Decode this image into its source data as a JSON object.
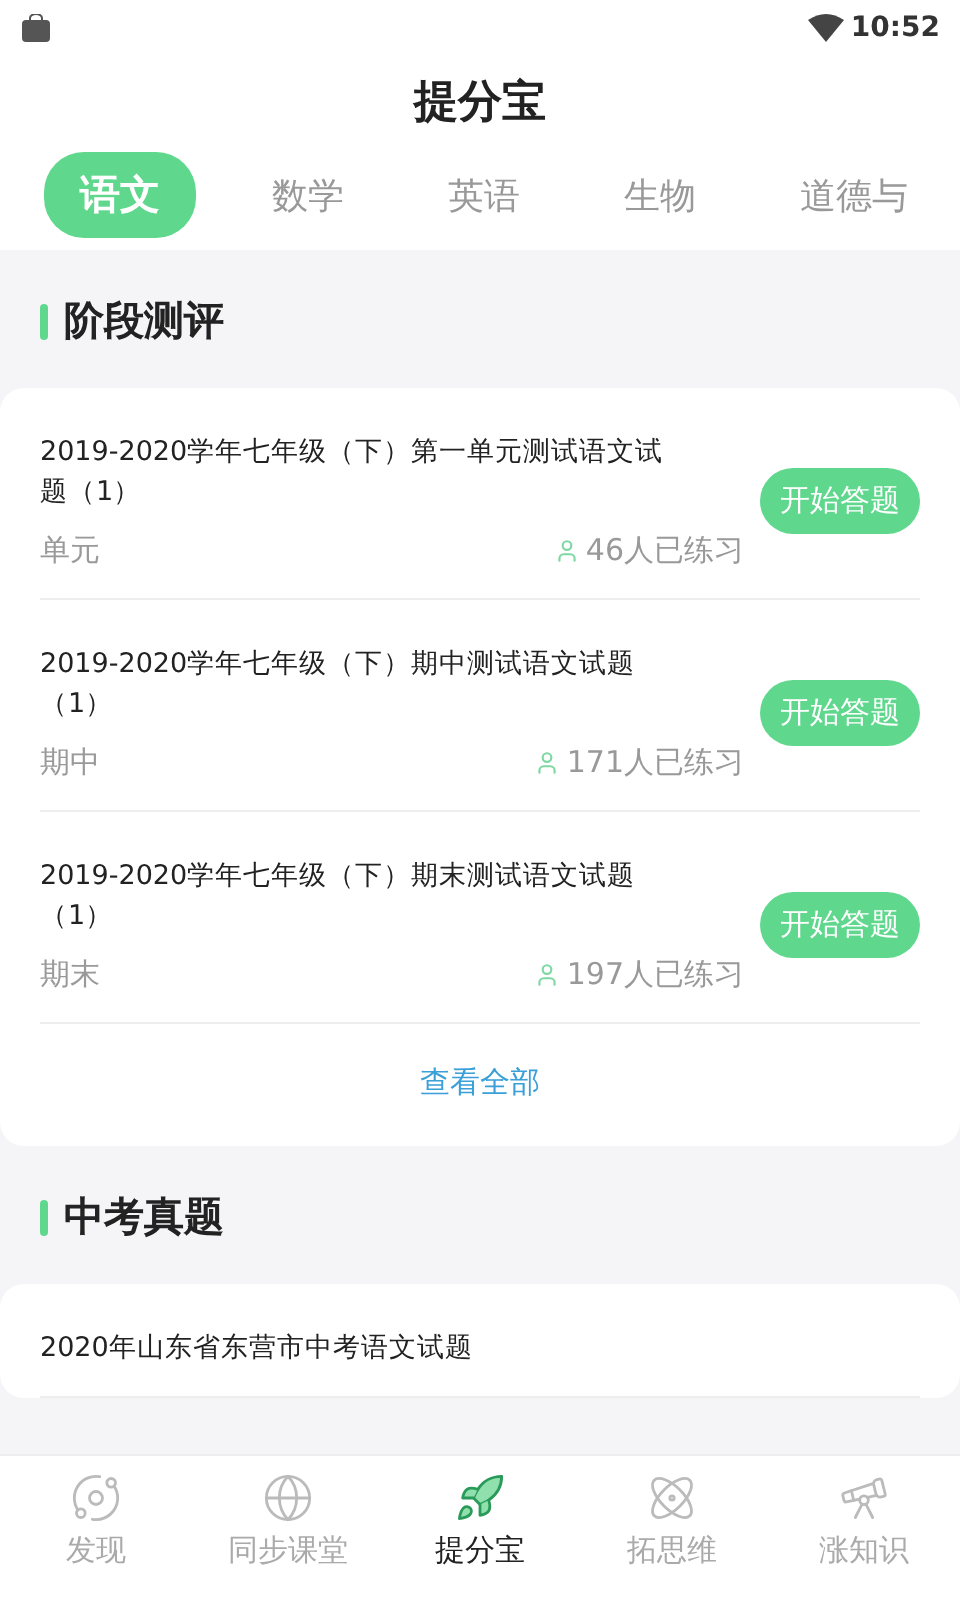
{
  "status_bar": {
    "time": "10:52"
  },
  "title": "提分宝",
  "tabs": [
    {
      "label": "语文",
      "selected": true
    },
    {
      "label": "数学",
      "selected": false
    },
    {
      "label": "英语",
      "selected": false
    },
    {
      "label": "生物",
      "selected": false
    },
    {
      "label": "道德与",
      "selected": false
    }
  ],
  "sections": [
    {
      "heading": "阶段测评",
      "items": [
        {
          "title": "2019-2020学年七年级（下）第一单元测试语文试题（1）",
          "tag": "单元",
          "count": "46人已练习",
          "button": "开始答题"
        },
        {
          "title": "2019-2020学年七年级（下）期中测试语文试题（1）",
          "tag": "期中",
          "count": "171人已练习",
          "button": "开始答题"
        },
        {
          "title": "2019-2020学年七年级（下）期末测试语文试题（1）",
          "tag": "期末",
          "count": "197人已练习",
          "button": "开始答题"
        }
      ],
      "more": "查看全部"
    },
    {
      "heading": "中考真题",
      "items": [
        {
          "title": "2020年山东省东营市中考语文试题"
        }
      ]
    }
  ],
  "nav": [
    {
      "label": "发现",
      "selected": false
    },
    {
      "label": "同步课堂",
      "selected": false
    },
    {
      "label": "提分宝",
      "selected": true
    },
    {
      "label": "拓思维",
      "selected": false
    },
    {
      "label": "涨知识",
      "selected": false
    }
  ]
}
